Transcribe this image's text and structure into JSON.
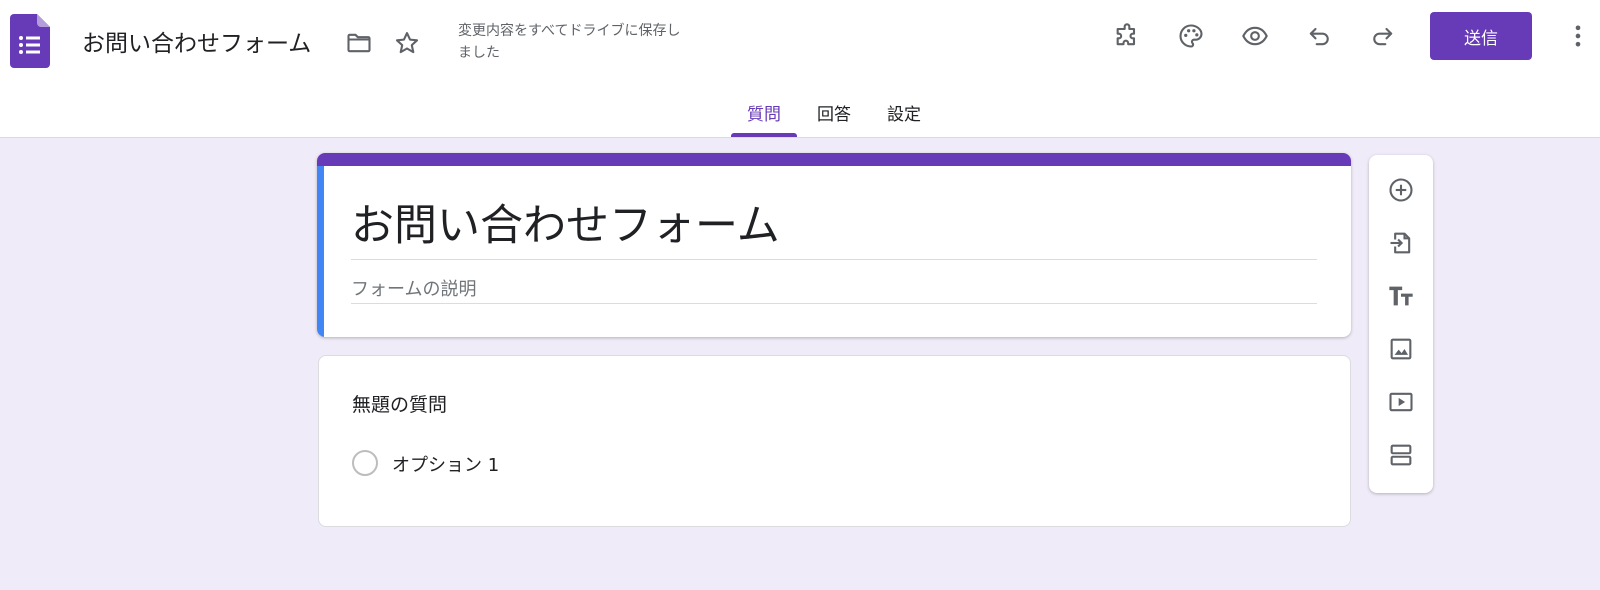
{
  "app": {
    "title": "お問い合わせフォーム",
    "save_status": "変更内容をすべてドライブに保存しました",
    "send_label": "送信"
  },
  "icons": {
    "logo": "google-forms-icon",
    "folder": "folder-icon",
    "star": "star-outline-icon",
    "addons": "puzzle-piece-icon",
    "theme": "palette-icon",
    "preview": "eye-icon",
    "undo": "undo-icon",
    "redo": "redo-icon",
    "more": "more-vertical-icon"
  },
  "tabs": [
    {
      "label": "質問",
      "active": true
    },
    {
      "label": "回答",
      "active": false
    },
    {
      "label": "設定",
      "active": false
    }
  ],
  "form": {
    "title": "お問い合わせフォーム",
    "description_placeholder": "フォームの説明"
  },
  "question": {
    "title": "無題の質問",
    "options": [
      "オプション 1"
    ]
  },
  "toolbar": {
    "items": [
      "add-question-icon",
      "import-questions-icon",
      "add-title-icon",
      "add-image-icon",
      "add-video-icon",
      "add-section-icon"
    ]
  },
  "colors": {
    "accent": "#673ab7",
    "accent_left_bar": "#4285f4",
    "background": "#f0ebf8",
    "icon": "#5f6368"
  }
}
